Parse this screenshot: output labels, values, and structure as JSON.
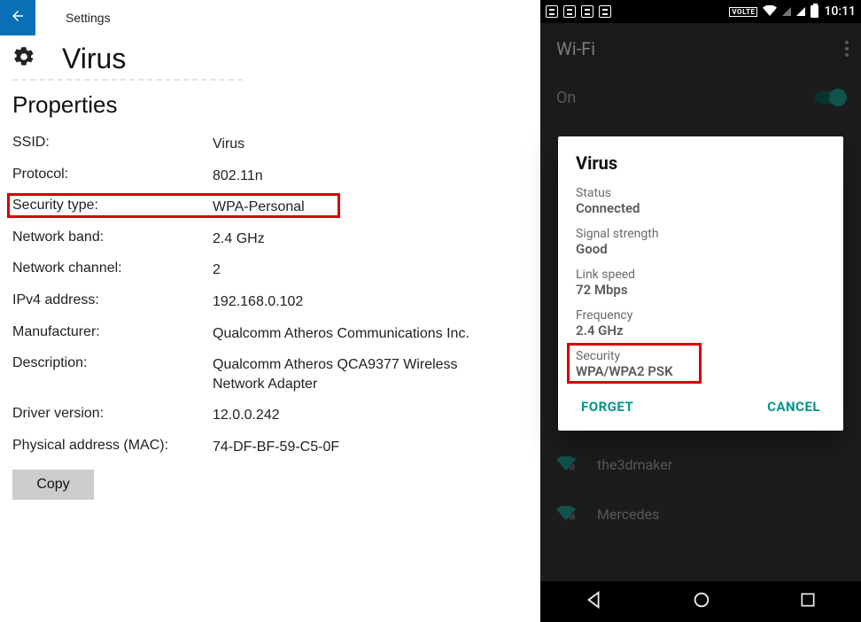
{
  "windows": {
    "settings_label": "Settings",
    "title": "Virus",
    "section_title": "Properties",
    "props": {
      "ssid": {
        "label": "SSID:",
        "value": "Virus"
      },
      "protocol": {
        "label": "Protocol:",
        "value": "802.11n"
      },
      "security": {
        "label": "Security type:",
        "value": "WPA-Personal"
      },
      "band": {
        "label": "Network band:",
        "value": "2.4 GHz"
      },
      "channel": {
        "label": "Network channel:",
        "value": "2"
      },
      "ipv4": {
        "label": "IPv4 address:",
        "value": "192.168.0.102"
      },
      "manufacturer": {
        "label": "Manufacturer:",
        "value": "Qualcomm Atheros Communications Inc."
      },
      "description": {
        "label": "Description:",
        "value": "Qualcomm Atheros QCA9377 Wireless Network Adapter"
      },
      "driver": {
        "label": "Driver version:",
        "value": "12.0.0.242"
      },
      "mac": {
        "label": "Physical address (MAC):",
        "value": "74-DF-BF-59-C5-0F"
      }
    },
    "copy_button": "Copy"
  },
  "android": {
    "status": {
      "volte": "VOLTE",
      "clock": "10:11"
    },
    "header_title": "Wi-Fi",
    "on_label": "On",
    "bg_networks": [
      "the3dmaker",
      "Mercedes"
    ],
    "dialog": {
      "title": "Virus",
      "status": {
        "k": "Status",
        "v": "Connected"
      },
      "signal": {
        "k": "Signal strength",
        "v": "Good"
      },
      "link": {
        "k": "Link speed",
        "v": "72 Mbps"
      },
      "freq": {
        "k": "Frequency",
        "v": "2.4 GHz"
      },
      "security": {
        "k": "Security",
        "v": "WPA/WPA2 PSK"
      },
      "forget": "FORGET",
      "cancel": "CANCEL"
    }
  },
  "colors": {
    "highlight": "#d60000",
    "win_accent": "#0a6fb6",
    "teal": "#009688"
  }
}
